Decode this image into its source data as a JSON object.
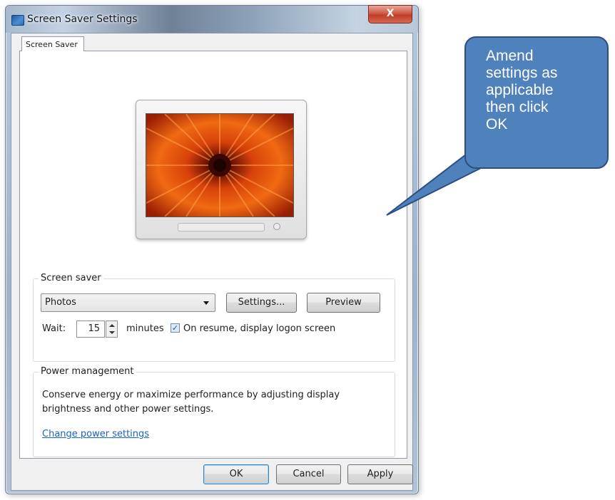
{
  "window": {
    "title": "Screen Saver Settings",
    "close_label": "X"
  },
  "tabs": [
    {
      "label": "Screen Saver"
    }
  ],
  "screen_saver_group": {
    "label": "Screen saver",
    "selected": "Photos",
    "settings_button": "Settings...",
    "preview_button": "Preview",
    "wait_label": "Wait:",
    "wait_value": "15",
    "minutes_label": "minutes",
    "resume_checked": true,
    "resume_label": "On resume, display logon screen"
  },
  "power_group": {
    "label": "Power management",
    "description": "Conserve energy or maximize performance by adjusting display brightness and other power settings.",
    "link": "Change power settings"
  },
  "footer": {
    "ok": "OK",
    "cancel": "Cancel",
    "apply": "Apply"
  },
  "callout": {
    "text": "Amend\nsettings as\napplicable\nthen click\nOK"
  },
  "colors": {
    "callout_fill": "#4f81bd",
    "link": "#1a61c8",
    "close_button": "#c23d25"
  },
  "icons": {
    "app": "monitor-icon",
    "close": "close-icon",
    "dropdown": "chevron-down-icon",
    "spin_up": "arrow-up-icon",
    "spin_down": "arrow-down-icon",
    "check": "checkmark-icon"
  }
}
